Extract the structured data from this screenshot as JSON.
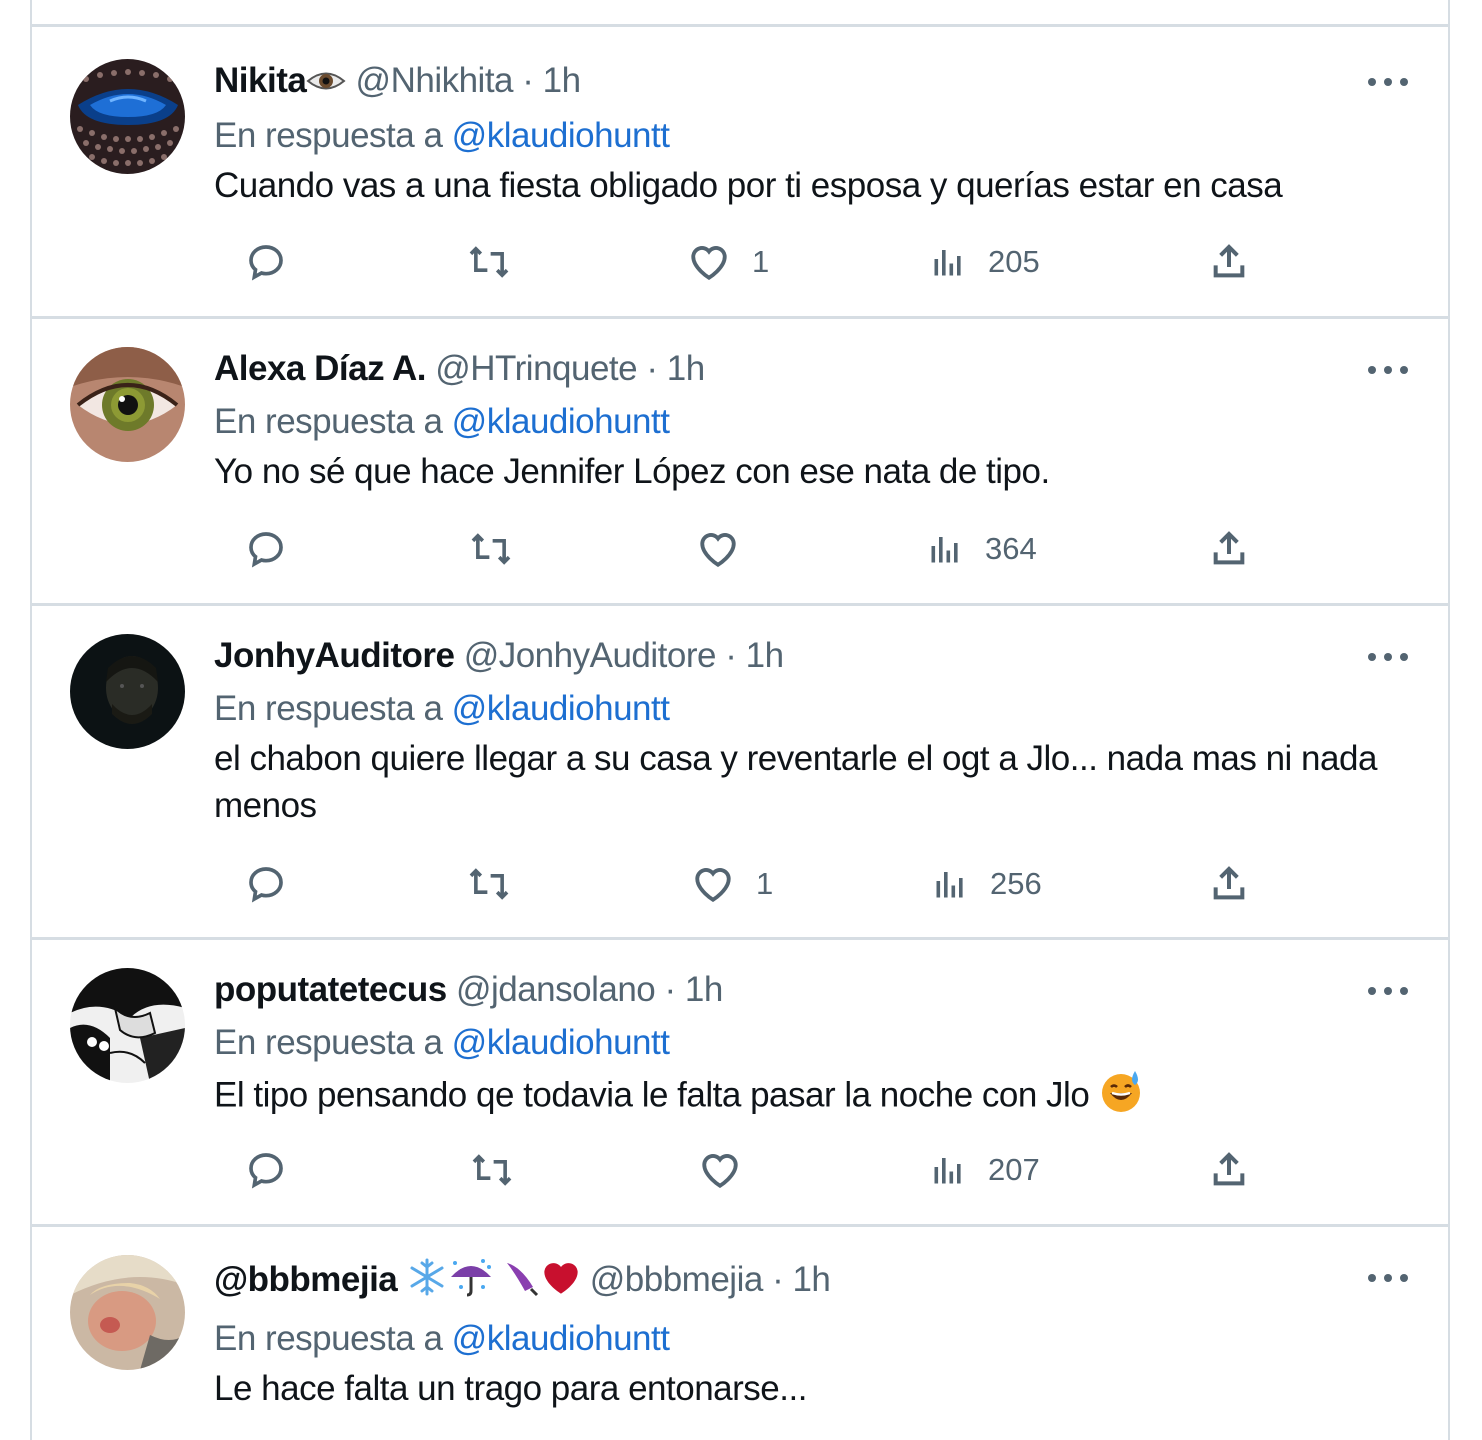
{
  "tweets": [
    {
      "name": "Nikita",
      "name_emoji": "eye-icon",
      "handle": "@Nhikhita",
      "time": "1h",
      "reply_prefix": "En respuesta a",
      "reply_to": "@klaudiohuntt",
      "text": "Cuando vas a una fiesta obligado por ti esposa y querías estar en casa",
      "replies": "",
      "retweets": "",
      "likes": "1",
      "views": "205"
    },
    {
      "name": "Alexa Díaz A.",
      "handle": "@HTrinquete",
      "time": "1h",
      "reply_prefix": "En respuesta a",
      "reply_to": "@klaudiohuntt",
      "text": "Yo no sé que hace Jennifer López con ese nata de tipo.",
      "replies": "",
      "retweets": "",
      "likes": "",
      "views": "364"
    },
    {
      "name": "JonhyAuditore",
      "handle": "@JonhyAuditore",
      "time": "1h",
      "reply_prefix": "En respuesta a",
      "reply_to": "@klaudiohuntt",
      "text": "el chabon quiere llegar a su casa y reventarle el ogt a Jlo... nada mas ni nada menos",
      "replies": "",
      "retweets": "",
      "likes": "1",
      "views": "256"
    },
    {
      "name": "poputatetecus",
      "handle": "@jdansolano",
      "time": "1h",
      "reply_prefix": "En respuesta a",
      "reply_to": "@klaudiohuntt",
      "text": "El tipo pensando qe todavia le falta pasar la noche con Jlo",
      "text_emoji": "grinning-sweat-emoji",
      "replies": "",
      "retweets": "",
      "likes": "",
      "views": "207"
    },
    {
      "name": "@bbbmejia",
      "name_emojis": [
        "snowflake-icon",
        "umbrella-rain-icon",
        "closed-umbrella-icon",
        "red-heart-icon"
      ],
      "handle": "@bbbmejia",
      "time": "1h",
      "reply_prefix": "En respuesta a",
      "reply_to": "@klaudiohuntt",
      "text": "Le hace falta un trago para entonarse..."
    }
  ],
  "dot_separator": "·",
  "colors": {
    "text": "#0f1419",
    "secondary": "#536471",
    "link": "#1d6fd1",
    "divider": "#d6dde3"
  }
}
